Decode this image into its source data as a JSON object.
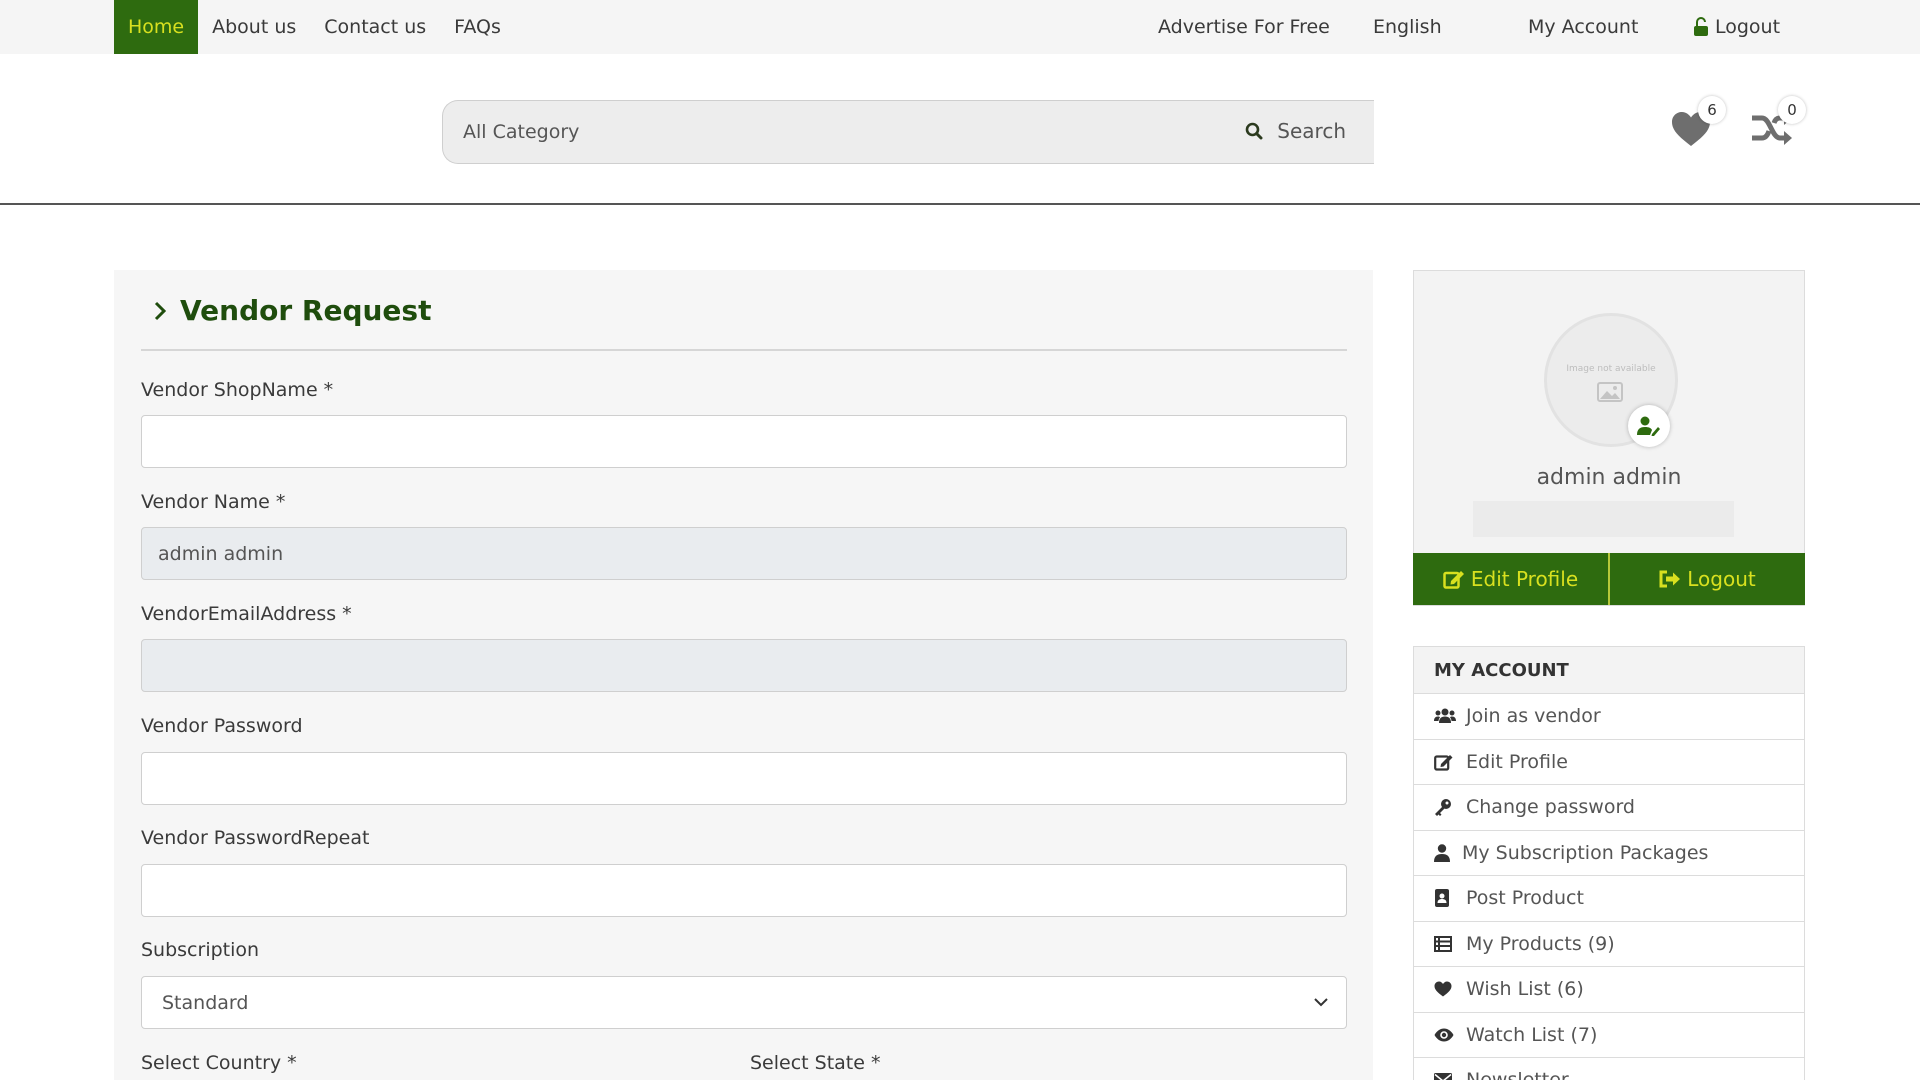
{
  "topnav": {
    "home": "Home",
    "about": "About us",
    "contact": "Contact us",
    "faqs": "FAQs",
    "advertise": "Advertise For Free",
    "language": "English",
    "account": "My Account",
    "logout": "Logout"
  },
  "search": {
    "category": "All Category",
    "button": "Search"
  },
  "header_icons": {
    "wishlist_count": "6",
    "compare_count": "0"
  },
  "form": {
    "title": "Vendor Request",
    "shop_name_label": "Vendor ShopName *",
    "shop_name_value": "",
    "vendor_name_label": "Vendor Name *",
    "vendor_name_value": "admin admin",
    "email_label": "VendorEmailAddress *",
    "email_value": "",
    "password_label": "Vendor Password",
    "password_repeat_label": "Vendor PasswordRepeat",
    "subscription_label": "Subscription",
    "subscription_value": "Standard",
    "country_label": "Select Country *",
    "state_label": "Select State *"
  },
  "profile": {
    "avatar_placeholder": "Image not available",
    "name": "admin admin",
    "edit_button": "Edit Profile",
    "logout_button": "Logout"
  },
  "account_menu": {
    "heading": "MY ACCOUNT",
    "items": [
      {
        "label": "Join as vendor",
        "icon": "users-icon"
      },
      {
        "label": "Edit Profile",
        "icon": "edit-icon"
      },
      {
        "label": "Change password",
        "icon": "key-icon"
      },
      {
        "label": "My Subscription Packages",
        "icon": "user-icon"
      },
      {
        "label": "Post Product",
        "icon": "contact-book-icon"
      },
      {
        "label": "My Products (9)",
        "icon": "list-icon"
      },
      {
        "label": "Wish List (6)",
        "icon": "heart-icon"
      },
      {
        "label": "Watch List (7)",
        "icon": "eye-icon"
      },
      {
        "label": "Newsletter",
        "icon": "envelope-icon"
      }
    ]
  },
  "colors": {
    "brand_green": "#2e6b0f",
    "brand_yellow": "#d8e01f",
    "title_green": "#1f4d0d"
  }
}
